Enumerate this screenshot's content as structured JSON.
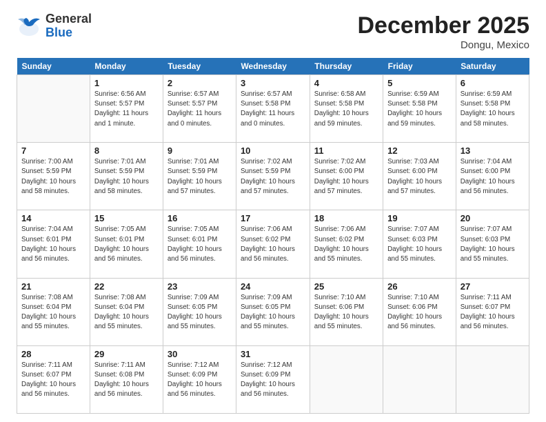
{
  "header": {
    "logo": {
      "general": "General",
      "blue": "Blue"
    },
    "title": "December 2025",
    "location": "Dongu, Mexico"
  },
  "weekdays": [
    "Sunday",
    "Monday",
    "Tuesday",
    "Wednesday",
    "Thursday",
    "Friday",
    "Saturday"
  ],
  "weeks": [
    [
      {
        "num": "",
        "info": ""
      },
      {
        "num": "1",
        "info": "Sunrise: 6:56 AM\nSunset: 5:57 PM\nDaylight: 11 hours\nand 1 minute."
      },
      {
        "num": "2",
        "info": "Sunrise: 6:57 AM\nSunset: 5:57 PM\nDaylight: 11 hours\nand 0 minutes."
      },
      {
        "num": "3",
        "info": "Sunrise: 6:57 AM\nSunset: 5:58 PM\nDaylight: 11 hours\nand 0 minutes."
      },
      {
        "num": "4",
        "info": "Sunrise: 6:58 AM\nSunset: 5:58 PM\nDaylight: 10 hours\nand 59 minutes."
      },
      {
        "num": "5",
        "info": "Sunrise: 6:59 AM\nSunset: 5:58 PM\nDaylight: 10 hours\nand 59 minutes."
      },
      {
        "num": "6",
        "info": "Sunrise: 6:59 AM\nSunset: 5:58 PM\nDaylight: 10 hours\nand 58 minutes."
      }
    ],
    [
      {
        "num": "7",
        "info": "Sunrise: 7:00 AM\nSunset: 5:59 PM\nDaylight: 10 hours\nand 58 minutes."
      },
      {
        "num": "8",
        "info": "Sunrise: 7:01 AM\nSunset: 5:59 PM\nDaylight: 10 hours\nand 58 minutes."
      },
      {
        "num": "9",
        "info": "Sunrise: 7:01 AM\nSunset: 5:59 PM\nDaylight: 10 hours\nand 57 minutes."
      },
      {
        "num": "10",
        "info": "Sunrise: 7:02 AM\nSunset: 5:59 PM\nDaylight: 10 hours\nand 57 minutes."
      },
      {
        "num": "11",
        "info": "Sunrise: 7:02 AM\nSunset: 6:00 PM\nDaylight: 10 hours\nand 57 minutes."
      },
      {
        "num": "12",
        "info": "Sunrise: 7:03 AM\nSunset: 6:00 PM\nDaylight: 10 hours\nand 57 minutes."
      },
      {
        "num": "13",
        "info": "Sunrise: 7:04 AM\nSunset: 6:00 PM\nDaylight: 10 hours\nand 56 minutes."
      }
    ],
    [
      {
        "num": "14",
        "info": "Sunrise: 7:04 AM\nSunset: 6:01 PM\nDaylight: 10 hours\nand 56 minutes."
      },
      {
        "num": "15",
        "info": "Sunrise: 7:05 AM\nSunset: 6:01 PM\nDaylight: 10 hours\nand 56 minutes."
      },
      {
        "num": "16",
        "info": "Sunrise: 7:05 AM\nSunset: 6:01 PM\nDaylight: 10 hours\nand 56 minutes."
      },
      {
        "num": "17",
        "info": "Sunrise: 7:06 AM\nSunset: 6:02 PM\nDaylight: 10 hours\nand 56 minutes."
      },
      {
        "num": "18",
        "info": "Sunrise: 7:06 AM\nSunset: 6:02 PM\nDaylight: 10 hours\nand 55 minutes."
      },
      {
        "num": "19",
        "info": "Sunrise: 7:07 AM\nSunset: 6:03 PM\nDaylight: 10 hours\nand 55 minutes."
      },
      {
        "num": "20",
        "info": "Sunrise: 7:07 AM\nSunset: 6:03 PM\nDaylight: 10 hours\nand 55 minutes."
      }
    ],
    [
      {
        "num": "21",
        "info": "Sunrise: 7:08 AM\nSunset: 6:04 PM\nDaylight: 10 hours\nand 55 minutes."
      },
      {
        "num": "22",
        "info": "Sunrise: 7:08 AM\nSunset: 6:04 PM\nDaylight: 10 hours\nand 55 minutes."
      },
      {
        "num": "23",
        "info": "Sunrise: 7:09 AM\nSunset: 6:05 PM\nDaylight: 10 hours\nand 55 minutes."
      },
      {
        "num": "24",
        "info": "Sunrise: 7:09 AM\nSunset: 6:05 PM\nDaylight: 10 hours\nand 55 minutes."
      },
      {
        "num": "25",
        "info": "Sunrise: 7:10 AM\nSunset: 6:06 PM\nDaylight: 10 hours\nand 55 minutes."
      },
      {
        "num": "26",
        "info": "Sunrise: 7:10 AM\nSunset: 6:06 PM\nDaylight: 10 hours\nand 56 minutes."
      },
      {
        "num": "27",
        "info": "Sunrise: 7:11 AM\nSunset: 6:07 PM\nDaylight: 10 hours\nand 56 minutes."
      }
    ],
    [
      {
        "num": "28",
        "info": "Sunrise: 7:11 AM\nSunset: 6:07 PM\nDaylight: 10 hours\nand 56 minutes."
      },
      {
        "num": "29",
        "info": "Sunrise: 7:11 AM\nSunset: 6:08 PM\nDaylight: 10 hours\nand 56 minutes."
      },
      {
        "num": "30",
        "info": "Sunrise: 7:12 AM\nSunset: 6:09 PM\nDaylight: 10 hours\nand 56 minutes."
      },
      {
        "num": "31",
        "info": "Sunrise: 7:12 AM\nSunset: 6:09 PM\nDaylight: 10 hours\nand 56 minutes."
      },
      {
        "num": "",
        "info": ""
      },
      {
        "num": "",
        "info": ""
      },
      {
        "num": "",
        "info": ""
      }
    ]
  ]
}
